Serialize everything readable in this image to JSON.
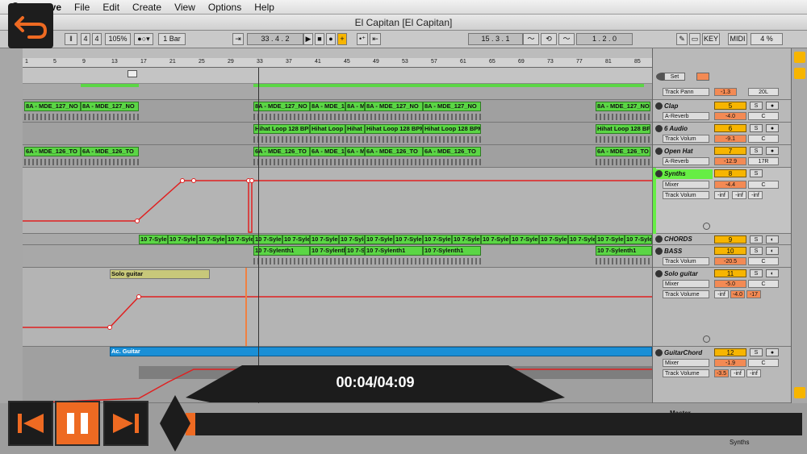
{
  "menu": {
    "app": "Live",
    "items": [
      "File",
      "Edit",
      "Create",
      "View",
      "Options",
      "Help"
    ]
  },
  "window": {
    "title": "El Capitan  [El Capitan]"
  },
  "transport": {
    "sig_num": "4",
    "sig_den": "4",
    "tempo": "105%",
    "quant": "1 Bar",
    "position": "33 .  4 .  2",
    "loop_start": "15 .  3 .  1",
    "loop_length": "1 .  2 .  0",
    "key": "KEY",
    "midi": "MIDI",
    "cpu": "4 %"
  },
  "ruler": {
    "bars": [
      "1",
      "5",
      "9",
      "13",
      "17",
      "21",
      "25",
      "29",
      "33",
      "37",
      "41",
      "45",
      "49",
      "53",
      "57",
      "61",
      "65",
      "69",
      "73",
      "77",
      "81",
      "85"
    ]
  },
  "arrangement": {
    "drums": {
      "row1": [
        "8A - MDE_127_NO",
        "8A - MDE_127_NO",
        "8A - MDE_127_NO",
        "8A - MDE_127_NO",
        "8A - M",
        "8A - MDE_127_NO",
        "8A - MDE_127_NO",
        "8A - MDE_127_NO"
      ],
      "row2": [
        "Hihat Loop 128 BPM",
        "Hihat Loop 128 BP",
        "Hihat Loop 128 BPM",
        "Hihat L",
        "Hihat Loop 128 BPM",
        "Hihat Loop 128 BPM",
        "Hihat Loop 128 BP"
      ],
      "row3": [
        "6A - MDE_126_TO",
        "6A - MDE_126_TO",
        "6A - MDE_126_TO",
        "6A - MDE_126_TO",
        "6A - M",
        "6A - MDE_126_TO",
        "6A - MDE_126_TO",
        "6A - MDE_126_TO"
      ]
    },
    "chords": "10 7-Syle",
    "bass": "10 7-Sylenth1",
    "solo_clip": "Solo guitar",
    "ac_clip": "Ac. Guitar"
  },
  "mixer": {
    "tracks": [
      {
        "name": "",
        "num": "",
        "routing": "Track Pann",
        "val1": "-1.3",
        "val2": "20L"
      },
      {
        "name": "Clap",
        "num": "5",
        "routing": "A-Reverb",
        "val1": "-4.0",
        "val2": "C"
      },
      {
        "name": "6 Audio",
        "num": "6",
        "routing": "Track Volum",
        "val1": "-9.1",
        "val2": "C"
      },
      {
        "name": "Open Hat",
        "num": "7",
        "routing": "A-Reverb",
        "val1": "-12.9",
        "val2": "17R"
      },
      {
        "name": "Synths",
        "num": "8",
        "routing": "Mixer",
        "routing2": "Track Volum",
        "val1": "-4.4",
        "val2": "C",
        "inf": "-inf"
      },
      {
        "name": "CHORDS",
        "num": "9"
      },
      {
        "name": "BASS",
        "num": "10",
        "routing": "Track Volum",
        "val1": "-20.5",
        "val2": "C"
      },
      {
        "name": "Solo guitar",
        "num": "11",
        "routing": "Mixer",
        "routing2": "Track Volume",
        "val1": "-5.0",
        "val2": "C",
        "inf": "-inf",
        "v3": "-4.0",
        "v4": "-17"
      },
      {
        "name": "GuitarChord",
        "num": "12",
        "routing": "Mixer",
        "routing2": "Track Volume",
        "val1": "-1.9",
        "val2": "C",
        "v3": "-3.5",
        "inf": "-inf"
      }
    ],
    "s_label": "S",
    "set_label": "Set",
    "master": "Master",
    "master_label": "Synths"
  },
  "player": {
    "time": "00:04/04:09",
    "fraction": 0.016
  },
  "colors": {
    "clip_green": "#5bd645",
    "automation": "#e02020",
    "track_orange": "#f7b500",
    "selected_green": "#66ee44",
    "ac_blue": "#1a8fd6",
    "player_orange": "#ee6a22"
  }
}
